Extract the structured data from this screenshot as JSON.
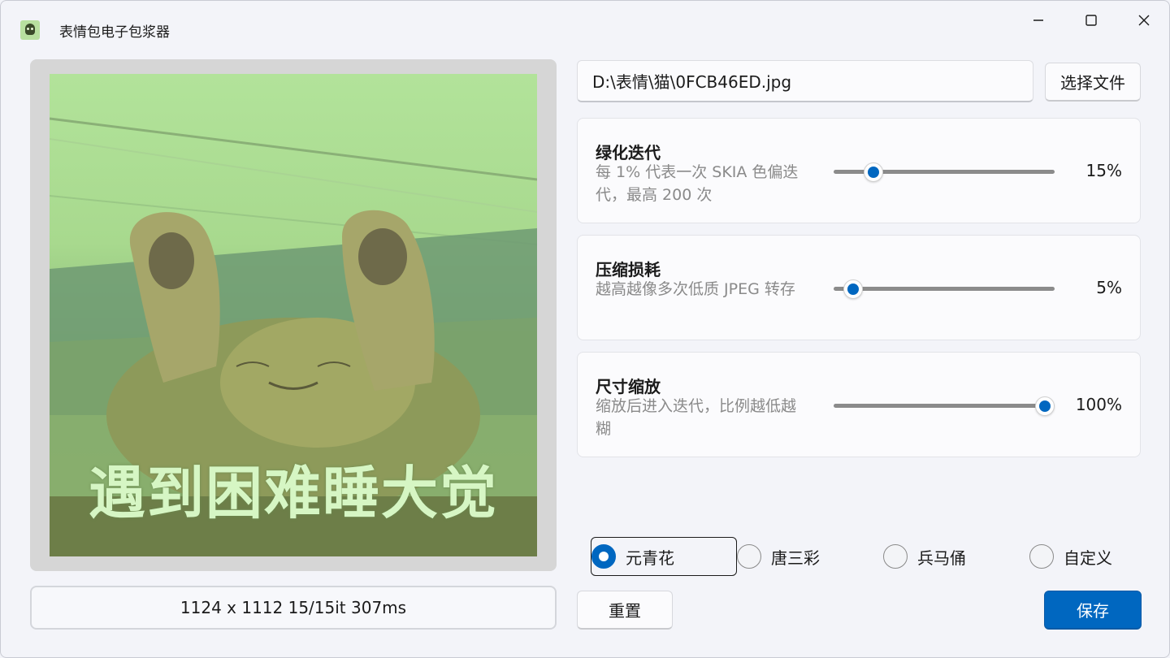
{
  "window": {
    "title": "表情包电子包浆器"
  },
  "preview": {
    "caption": "遇到困难睡大觉",
    "status": "1124 x 1112 15/15it 307ms"
  },
  "file": {
    "path": "D:\\表情\\猫\\0FCB46ED.jpg",
    "choose_label": "选择文件"
  },
  "settings": [
    {
      "title": "绿化迭代",
      "description": "每 1% 代表一次 SKIA 色偏迭代，最高 200 次",
      "value": 15,
      "value_label": "15%"
    },
    {
      "title": "压缩损耗",
      "description": "越高越像多次低质 JPEG 转存",
      "value": 5,
      "value_label": "5%"
    },
    {
      "title": "尺寸缩放",
      "description": "缩放后进入迭代，比例越低越糊",
      "value": 100,
      "value_label": "100%"
    }
  ],
  "presets": [
    {
      "label": "元青花",
      "selected": true
    },
    {
      "label": "唐三彩",
      "selected": false
    },
    {
      "label": "兵马俑",
      "selected": false
    },
    {
      "label": "自定义",
      "selected": false
    }
  ],
  "actions": {
    "reset_label": "重置",
    "save_label": "保存"
  },
  "colors": {
    "accent": "#0067c0",
    "preview_green": "#a8d98e"
  }
}
